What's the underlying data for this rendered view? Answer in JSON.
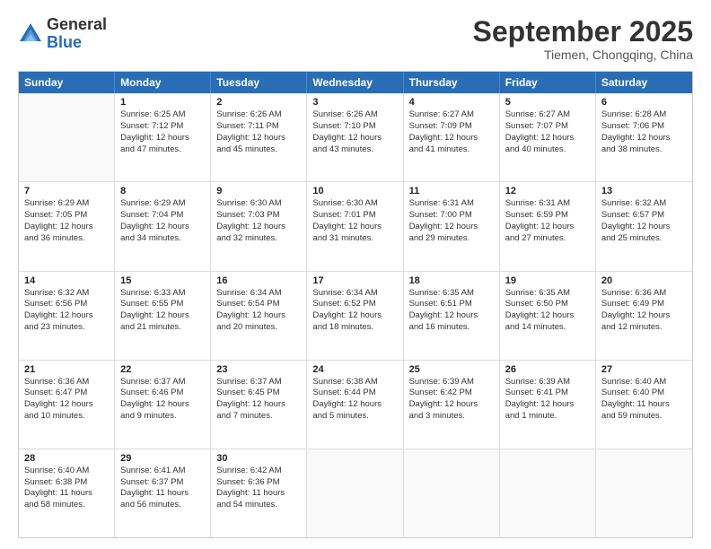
{
  "logo": {
    "general": "General",
    "blue": "Blue"
  },
  "header": {
    "month": "September 2025",
    "location": "Tiemen, Chongqing, China"
  },
  "days": [
    "Sunday",
    "Monday",
    "Tuesday",
    "Wednesday",
    "Thursday",
    "Friday",
    "Saturday"
  ],
  "weeks": [
    [
      {
        "day": "",
        "lines": []
      },
      {
        "day": "1",
        "lines": [
          "Sunrise: 6:25 AM",
          "Sunset: 7:12 PM",
          "Daylight: 12 hours",
          "and 47 minutes."
        ]
      },
      {
        "day": "2",
        "lines": [
          "Sunrise: 6:26 AM",
          "Sunset: 7:11 PM",
          "Daylight: 12 hours",
          "and 45 minutes."
        ]
      },
      {
        "day": "3",
        "lines": [
          "Sunrise: 6:26 AM",
          "Sunset: 7:10 PM",
          "Daylight: 12 hours",
          "and 43 minutes."
        ]
      },
      {
        "day": "4",
        "lines": [
          "Sunrise: 6:27 AM",
          "Sunset: 7:09 PM",
          "Daylight: 12 hours",
          "and 41 minutes."
        ]
      },
      {
        "day": "5",
        "lines": [
          "Sunrise: 6:27 AM",
          "Sunset: 7:07 PM",
          "Daylight: 12 hours",
          "and 40 minutes."
        ]
      },
      {
        "day": "6",
        "lines": [
          "Sunrise: 6:28 AM",
          "Sunset: 7:06 PM",
          "Daylight: 12 hours",
          "and 38 minutes."
        ]
      }
    ],
    [
      {
        "day": "7",
        "lines": [
          "Sunrise: 6:29 AM",
          "Sunset: 7:05 PM",
          "Daylight: 12 hours",
          "and 36 minutes."
        ]
      },
      {
        "day": "8",
        "lines": [
          "Sunrise: 6:29 AM",
          "Sunset: 7:04 PM",
          "Daylight: 12 hours",
          "and 34 minutes."
        ]
      },
      {
        "day": "9",
        "lines": [
          "Sunrise: 6:30 AM",
          "Sunset: 7:03 PM",
          "Daylight: 12 hours",
          "and 32 minutes."
        ]
      },
      {
        "day": "10",
        "lines": [
          "Sunrise: 6:30 AM",
          "Sunset: 7:01 PM",
          "Daylight: 12 hours",
          "and 31 minutes."
        ]
      },
      {
        "day": "11",
        "lines": [
          "Sunrise: 6:31 AM",
          "Sunset: 7:00 PM",
          "Daylight: 12 hours",
          "and 29 minutes."
        ]
      },
      {
        "day": "12",
        "lines": [
          "Sunrise: 6:31 AM",
          "Sunset: 6:59 PM",
          "Daylight: 12 hours",
          "and 27 minutes."
        ]
      },
      {
        "day": "13",
        "lines": [
          "Sunrise: 6:32 AM",
          "Sunset: 6:57 PM",
          "Daylight: 12 hours",
          "and 25 minutes."
        ]
      }
    ],
    [
      {
        "day": "14",
        "lines": [
          "Sunrise: 6:32 AM",
          "Sunset: 6:56 PM",
          "Daylight: 12 hours",
          "and 23 minutes."
        ]
      },
      {
        "day": "15",
        "lines": [
          "Sunrise: 6:33 AM",
          "Sunset: 6:55 PM",
          "Daylight: 12 hours",
          "and 21 minutes."
        ]
      },
      {
        "day": "16",
        "lines": [
          "Sunrise: 6:34 AM",
          "Sunset: 6:54 PM",
          "Daylight: 12 hours",
          "and 20 minutes."
        ]
      },
      {
        "day": "17",
        "lines": [
          "Sunrise: 6:34 AM",
          "Sunset: 6:52 PM",
          "Daylight: 12 hours",
          "and 18 minutes."
        ]
      },
      {
        "day": "18",
        "lines": [
          "Sunrise: 6:35 AM",
          "Sunset: 6:51 PM",
          "Daylight: 12 hours",
          "and 16 minutes."
        ]
      },
      {
        "day": "19",
        "lines": [
          "Sunrise: 6:35 AM",
          "Sunset: 6:50 PM",
          "Daylight: 12 hours",
          "and 14 minutes."
        ]
      },
      {
        "day": "20",
        "lines": [
          "Sunrise: 6:36 AM",
          "Sunset: 6:49 PM",
          "Daylight: 12 hours",
          "and 12 minutes."
        ]
      }
    ],
    [
      {
        "day": "21",
        "lines": [
          "Sunrise: 6:36 AM",
          "Sunset: 6:47 PM",
          "Daylight: 12 hours",
          "and 10 minutes."
        ]
      },
      {
        "day": "22",
        "lines": [
          "Sunrise: 6:37 AM",
          "Sunset: 6:46 PM",
          "Daylight: 12 hours",
          "and 9 minutes."
        ]
      },
      {
        "day": "23",
        "lines": [
          "Sunrise: 6:37 AM",
          "Sunset: 6:45 PM",
          "Daylight: 12 hours",
          "and 7 minutes."
        ]
      },
      {
        "day": "24",
        "lines": [
          "Sunrise: 6:38 AM",
          "Sunset: 6:44 PM",
          "Daylight: 12 hours",
          "and 5 minutes."
        ]
      },
      {
        "day": "25",
        "lines": [
          "Sunrise: 6:39 AM",
          "Sunset: 6:42 PM",
          "Daylight: 12 hours",
          "and 3 minutes."
        ]
      },
      {
        "day": "26",
        "lines": [
          "Sunrise: 6:39 AM",
          "Sunset: 6:41 PM",
          "Daylight: 12 hours",
          "and 1 minute."
        ]
      },
      {
        "day": "27",
        "lines": [
          "Sunrise: 6:40 AM",
          "Sunset: 6:40 PM",
          "Daylight: 11 hours",
          "and 59 minutes."
        ]
      }
    ],
    [
      {
        "day": "28",
        "lines": [
          "Sunrise: 6:40 AM",
          "Sunset: 6:38 PM",
          "Daylight: 11 hours",
          "and 58 minutes."
        ]
      },
      {
        "day": "29",
        "lines": [
          "Sunrise: 6:41 AM",
          "Sunset: 6:37 PM",
          "Daylight: 11 hours",
          "and 56 minutes."
        ]
      },
      {
        "day": "30",
        "lines": [
          "Sunrise: 6:42 AM",
          "Sunset: 6:36 PM",
          "Daylight: 11 hours",
          "and 54 minutes."
        ]
      },
      {
        "day": "",
        "lines": []
      },
      {
        "day": "",
        "lines": []
      },
      {
        "day": "",
        "lines": []
      },
      {
        "day": "",
        "lines": []
      }
    ]
  ]
}
